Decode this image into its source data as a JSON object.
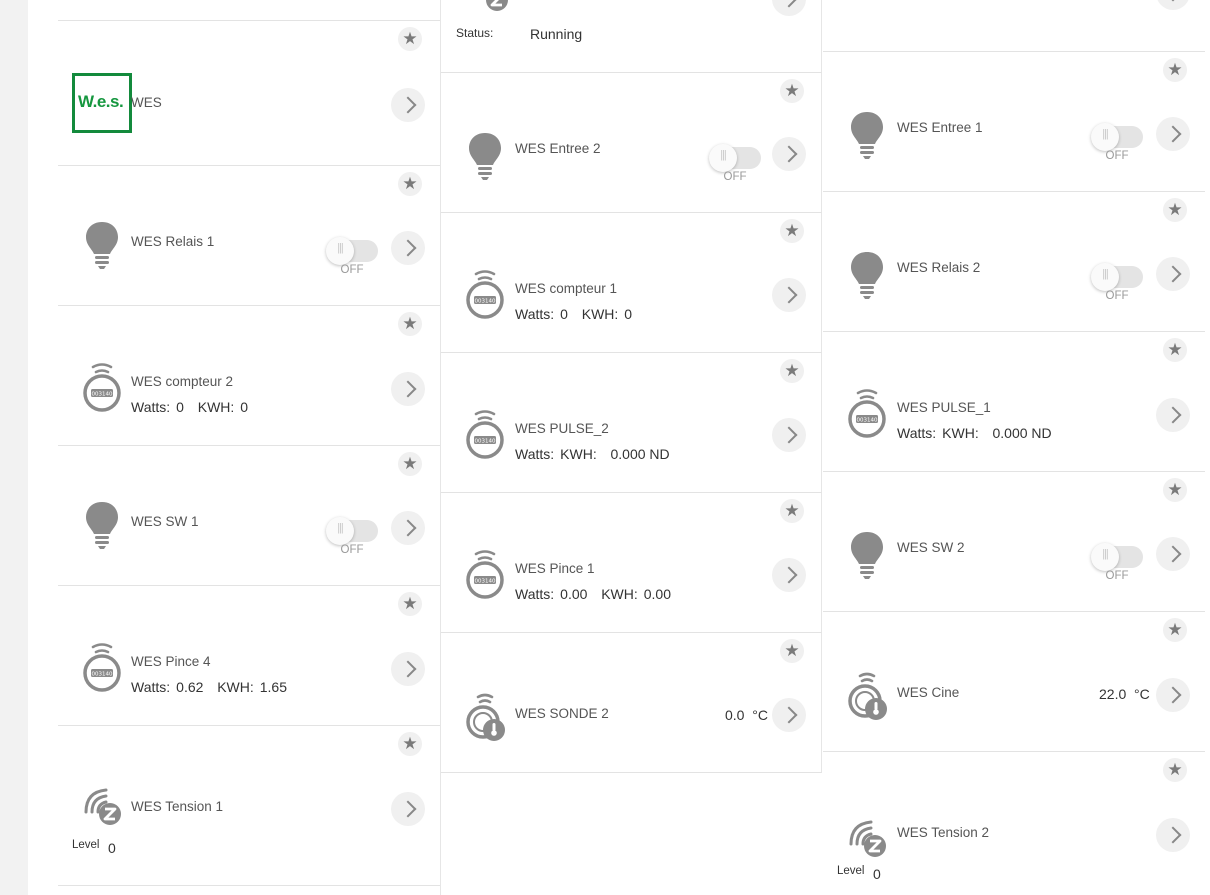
{
  "col1": {
    "wes": {
      "name": "WES",
      "logo_text": "W.e.s."
    },
    "relais1": {
      "name": "WES Relais 1",
      "state": "OFF"
    },
    "compteur2": {
      "name": "WES compteur 2",
      "watts_label": "Watts:",
      "watts": "0",
      "kwh_label": "KWH:",
      "kwh": "0"
    },
    "sw1": {
      "name": "WES SW 1",
      "state": "OFF"
    },
    "pince4": {
      "name": "WES Pince 4",
      "watts_label": "Watts:",
      "watts": "0.62",
      "kwh_label": "KWH:",
      "kwh": "1.65"
    },
    "tension1": {
      "name": "WES Tension 1",
      "level_label": "Level",
      "level": "0"
    }
  },
  "col2": {
    "status": {
      "label": "Status:",
      "value": "Running"
    },
    "entree2": {
      "name": "WES Entree 2",
      "state": "OFF"
    },
    "compteur1": {
      "name": "WES compteur 1",
      "watts_label": "Watts:",
      "watts": "0",
      "kwh_label": "KWH:",
      "kwh": "0"
    },
    "pulse2": {
      "name": "WES PULSE_2",
      "watts_label": "Watts:",
      "kwh_label": "KWH:",
      "kwh": "0.000 ND"
    },
    "pince1": {
      "name": "WES Pince 1",
      "watts_label": "Watts:",
      "watts": "0.00",
      "kwh_label": "KWH:",
      "kwh": "0.00"
    },
    "sonde2": {
      "name": "WES SONDE 2",
      "temp": "0.0",
      "unit": "°C"
    }
  },
  "col3": {
    "entree1": {
      "name": "WES Entree 1",
      "state": "OFF"
    },
    "relais2": {
      "name": "WES Relais 2",
      "state": "OFF"
    },
    "pulse1": {
      "name": "WES PULSE_1",
      "watts_label": "Watts:",
      "kwh_label": "KWH:",
      "kwh": "0.000 ND"
    },
    "sw2": {
      "name": "WES SW 2",
      "state": "OFF"
    },
    "cine": {
      "name": "WES Cine",
      "temp": "22.0",
      "unit": "°C"
    },
    "tension2": {
      "name": "WES Tension 2",
      "level_label": "Level",
      "level": "0"
    }
  },
  "icons": {
    "favorite": "star-icon",
    "open": "chevron-right-icon",
    "light": "light-bulb-icon",
    "meter": "energy-meter-icon",
    "temperature": "temperature-sensor-icon",
    "zwave": "zwave-device-icon"
  },
  "colors": {
    "brand_green": "#16973f",
    "icon_grey": "#8a8a8a",
    "toggle_track": "#e4e4e4"
  }
}
